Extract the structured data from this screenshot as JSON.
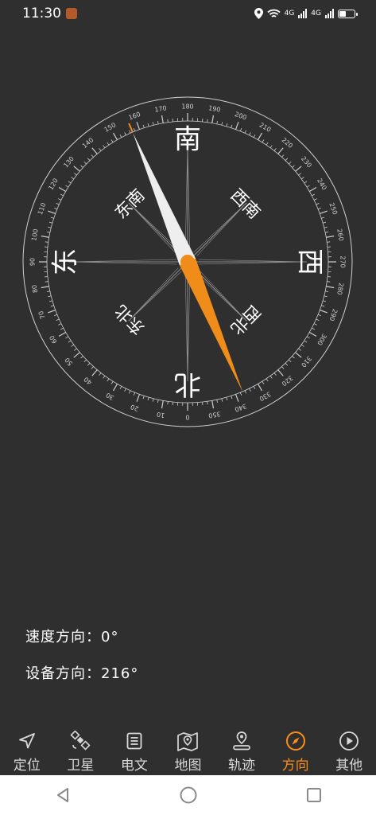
{
  "status_bar": {
    "time": "11:30",
    "network_label_1": "4G",
    "network_label_2": "4G"
  },
  "compass": {
    "dial_rotation_deg": 180,
    "needle_heading_deg": 157,
    "ring_numbers": [
      0,
      10,
      20,
      30,
      40,
      50,
      60,
      70,
      80,
      90,
      100,
      110,
      120,
      130,
      140,
      150,
      160,
      170,
      180,
      190,
      200,
      210,
      220,
      230,
      240,
      250,
      260,
      270,
      280,
      290,
      300,
      310,
      320,
      330,
      340,
      350
    ],
    "cardinals": [
      {
        "label": "北",
        "deg": 0
      },
      {
        "label": "东",
        "deg": 90
      },
      {
        "label": "南",
        "deg": 180
      },
      {
        "label": "西",
        "deg": 270
      }
    ],
    "intercardinals": [
      {
        "label": "东北",
        "deg": 45
      },
      {
        "label": "东南",
        "deg": 135
      },
      {
        "label": "西南",
        "deg": 225
      },
      {
        "label": "西北",
        "deg": 315
      }
    ],
    "colors": {
      "accent": "#f08c1a",
      "needle_white": "#eeeeee",
      "ring": "#cfcfcf"
    }
  },
  "info": {
    "speed_label": "速度方向：",
    "speed_value": "0°",
    "device_label": "设备方向：",
    "device_value": "216°"
  },
  "bottom_nav": {
    "items": [
      {
        "label": "定位",
        "icon": "location-arrow-icon"
      },
      {
        "label": "卫星",
        "icon": "satellite-icon"
      },
      {
        "label": "电文",
        "icon": "document-icon"
      },
      {
        "label": "地图",
        "icon": "map-icon"
      },
      {
        "label": "轨迹",
        "icon": "track-pin-icon"
      },
      {
        "label": "方向",
        "icon": "compass-icon",
        "active": true
      },
      {
        "label": "其他",
        "icon": "play-circle-icon"
      }
    ]
  }
}
